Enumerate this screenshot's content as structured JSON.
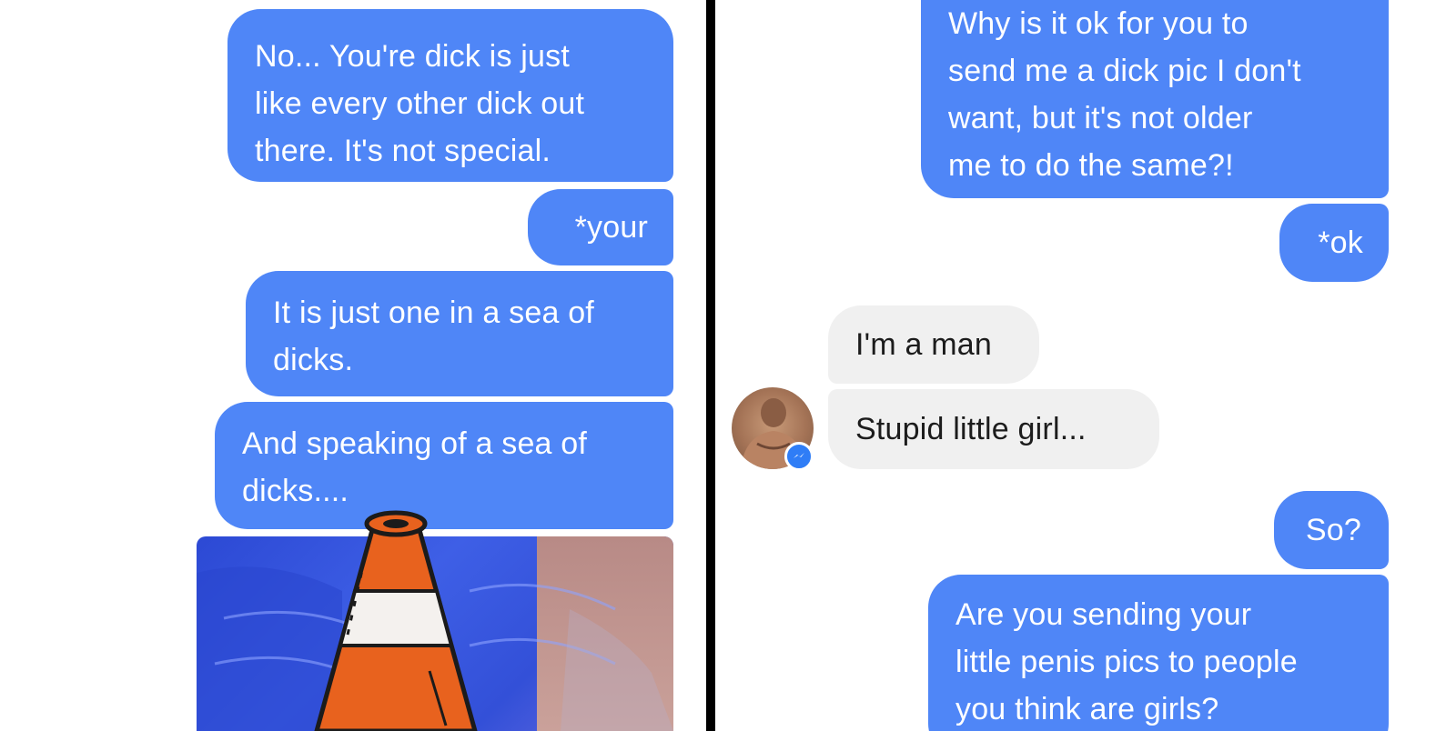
{
  "left_panel": {
    "messages": [
      {
        "sender": "me",
        "text": "No... You're dick is just\nlike every other dick out\nthere. It's not special."
      },
      {
        "sender": "me",
        "text": "*your"
      },
      {
        "sender": "me",
        "text": "It is just one in a sea of\ndicks."
      },
      {
        "sender": "me",
        "text": "And speaking of a sea of\ndicks...."
      }
    ],
    "attachment": {
      "kind": "photo",
      "overlay_icon": "traffic-cone-icon"
    }
  },
  "right_panel": {
    "messages": [
      {
        "sender": "me",
        "text": "Why is it ok for you to\nsend me a dick pic I don't\nwant, but it's not older\nme to do the same?!"
      },
      {
        "sender": "me",
        "text": "*ok"
      },
      {
        "sender": "them",
        "text": "I'm a man"
      },
      {
        "sender": "them",
        "text": "Stupid little girl..."
      },
      {
        "sender": "me",
        "text": "So?"
      },
      {
        "sender": "me",
        "text": "Are you sending your\nlittle penis pics to people\nyou think are girls?"
      }
    ],
    "avatar_badge_icon": "messenger-icon"
  },
  "colors": {
    "sent_bubble": "#4f86f7",
    "received_bubble": "#f0f0f0",
    "divider": "#000000",
    "cone_orange": "#e8621e"
  }
}
